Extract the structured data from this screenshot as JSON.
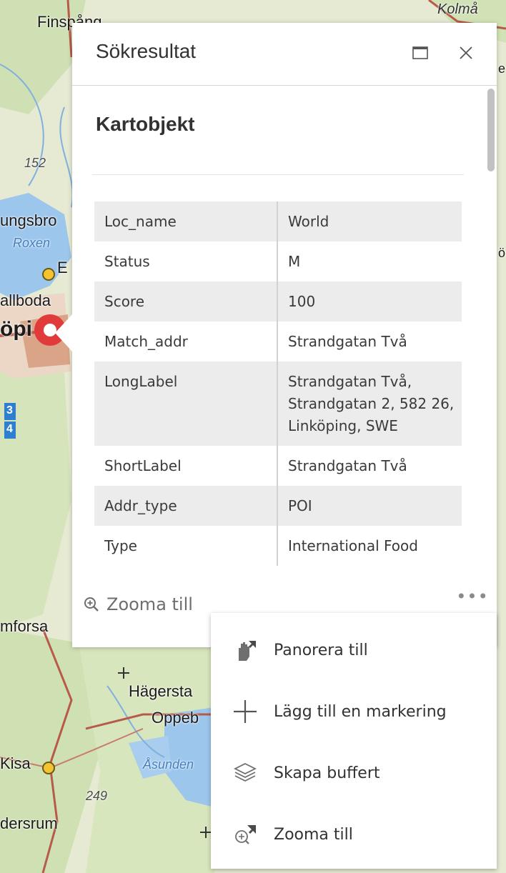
{
  "map": {
    "labels": {
      "finspang": "Finspång",
      "kolmarden": "Kolmå",
      "elev_152": "152",
      "ljungsbro": "ungsbro",
      "roxen": "Roxen",
      "e_marker": "E",
      "vallboda": "allboda",
      "linkoping": "öpi",
      "route_3": "3",
      "route_4": "4",
      "rimforsa": "mforsa",
      "hagerstad": "Hägersta",
      "oppeby": "Oppeb",
      "kisa": "Kisa",
      "asunden": "Åsunden",
      "elev_249": "249",
      "vardersrum": "dersrum",
      "edge_ne": "e",
      "edge_e": "ö"
    }
  },
  "popup": {
    "title": "Sökresultat",
    "dock_icon": "dock-icon",
    "close_icon": "close-icon",
    "section_title": "Kartobjekt",
    "attributes": [
      {
        "key": "Loc_name",
        "value": "World"
      },
      {
        "key": "Status",
        "value": "M"
      },
      {
        "key": "Score",
        "value": "100"
      },
      {
        "key": "Match_addr",
        "value": "Strandgatan Två"
      },
      {
        "key": "LongLabel",
        "value": "Strandgatan Två, Strandgatan 2, 582 26, Linköping, SWE"
      },
      {
        "key": "ShortLabel",
        "value": "Strandgatan Två"
      },
      {
        "key": "Addr_type",
        "value": "POI"
      },
      {
        "key": "Type",
        "value": "International Food"
      }
    ],
    "footer": {
      "zoom_label": "Zooma till",
      "zoom_icon": "zoom-in-icon",
      "more_label": "•••"
    }
  },
  "action_menu": {
    "items": [
      {
        "label": "Panorera till",
        "icon": "pan-hand-icon"
      },
      {
        "label": "Lägg till en markering",
        "icon": "plus-icon"
      },
      {
        "label": "Skapa buffert",
        "icon": "layers-icon"
      },
      {
        "label": "Zooma till",
        "icon": "zoom-to-icon"
      }
    ]
  },
  "colors": {
    "accent_marker": "#e03a3a",
    "place_dot": "#f4c430",
    "road": "#b85a4a",
    "water": "#9cc6ec"
  }
}
